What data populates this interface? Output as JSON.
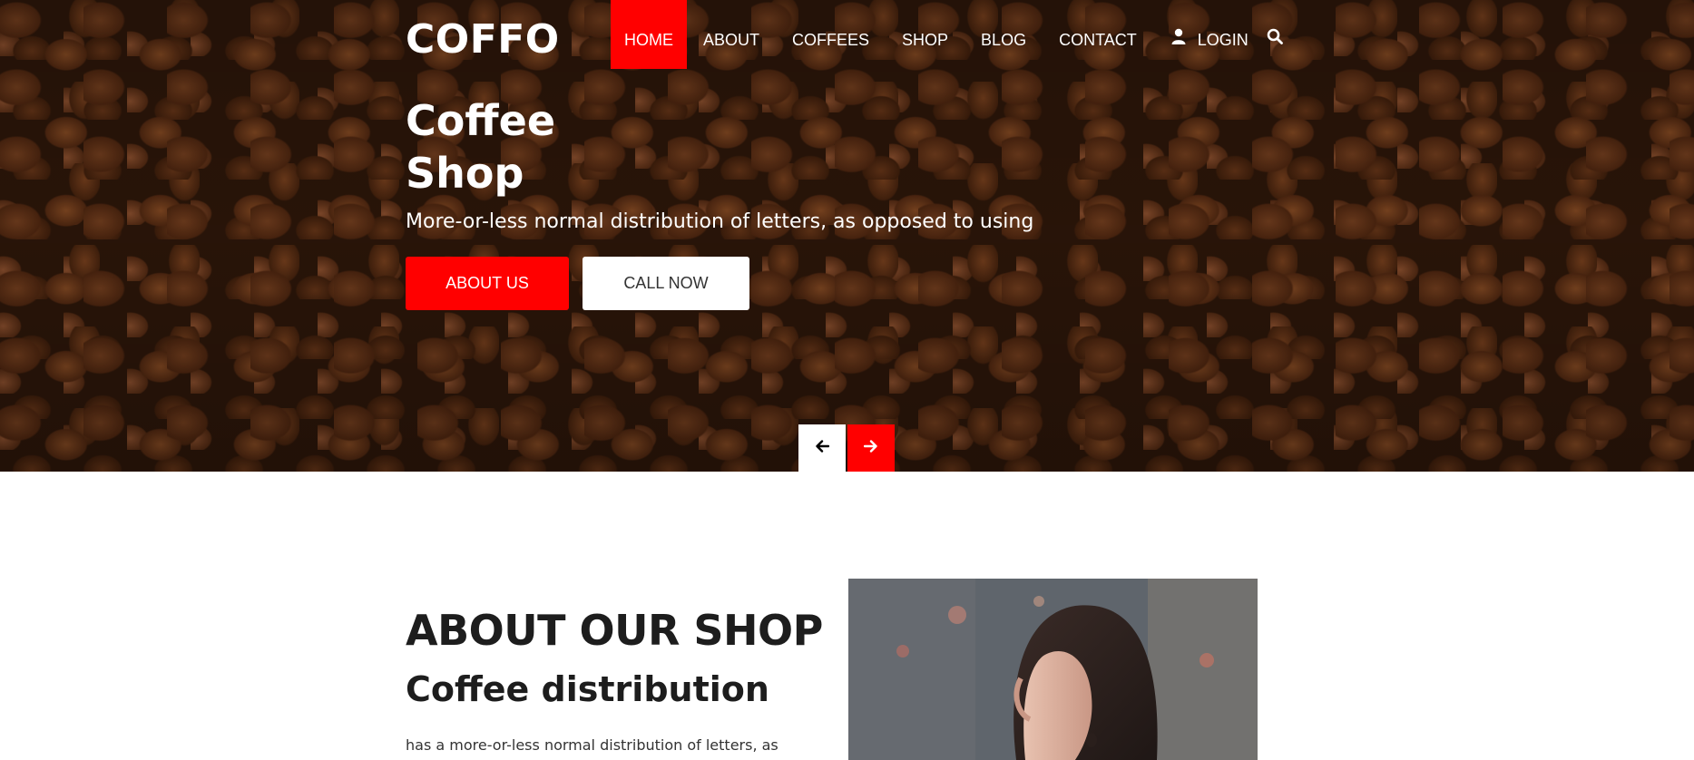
{
  "brand": {
    "logo": "COFFO",
    "accent_color": "#ff0000"
  },
  "nav": {
    "items": [
      {
        "label": "HOME",
        "active": true
      },
      {
        "label": "ABOUT",
        "active": false
      },
      {
        "label": "COFFEES",
        "active": false
      },
      {
        "label": "SHOP",
        "active": false
      },
      {
        "label": "BLOG",
        "active": false
      },
      {
        "label": "CONTACT",
        "active": false
      }
    ],
    "login_label": "LOGIN",
    "login_icon": "user-icon",
    "search_icon": "search-icon"
  },
  "hero": {
    "title": "Coffee Shop",
    "subtitle": "More-or-less normal distribution of letters, as opposed to using",
    "primary_button": "ABOUT US",
    "secondary_button": "CALL NOW",
    "prev_icon": "arrow-left-icon",
    "next_icon": "arrow-right-icon"
  },
  "about": {
    "title": "ABOUT OUR SHOP",
    "subtitle": "Coffee distribution",
    "text": "has a more-or-less normal distribution of letters, as"
  }
}
